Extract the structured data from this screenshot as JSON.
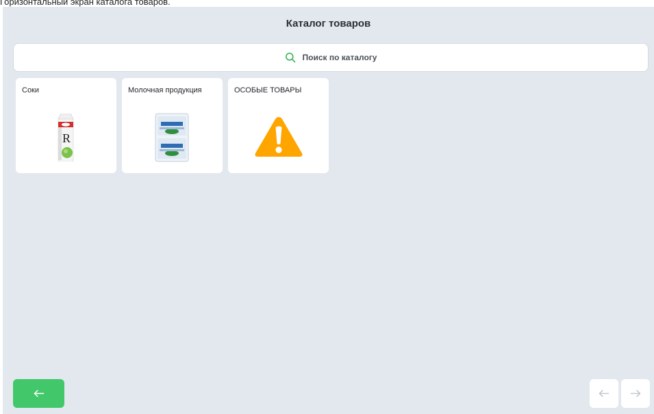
{
  "caption": "Горизонтальный экран каталога товаров.",
  "header": {
    "title": "Каталог товаров"
  },
  "search": {
    "placeholder": "Поиск по каталогу",
    "icon": "search-icon"
  },
  "categories": [
    {
      "label": "Соки",
      "icon": "juice-carton-icon"
    },
    {
      "label": "Молочная продукция",
      "icon": "dairy-package-icon"
    },
    {
      "label": "ОСОБЫЕ ТОВАРЫ",
      "icon": "warning-icon"
    }
  ],
  "navigation": {
    "back_icon": "arrow-left-icon",
    "prev_icon": "arrow-left-icon",
    "next_icon": "arrow-right-icon"
  },
  "colors": {
    "background": "#e3e8ee",
    "accent_green": "#42c86a",
    "warning_orange": "#ffa500"
  }
}
